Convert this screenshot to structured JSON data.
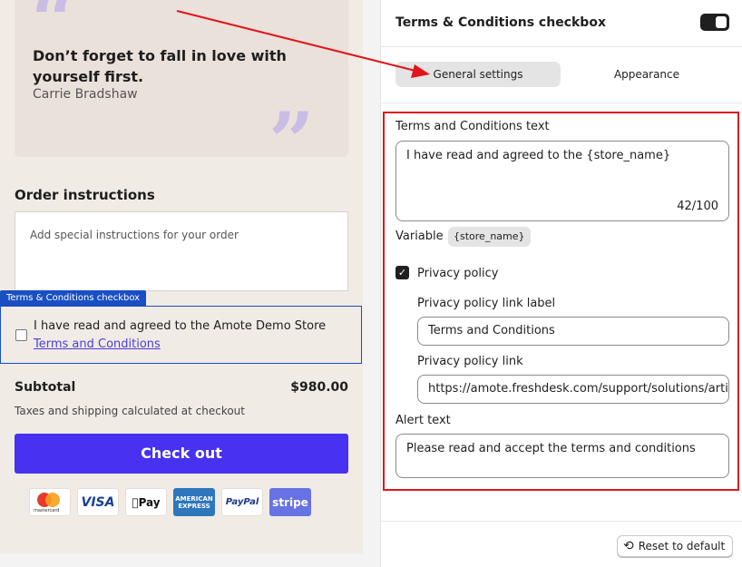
{
  "preview": {
    "quote": {
      "text": "Don’t forget to fall in love with yourself first.",
      "author": "Carrie Bradshaw"
    },
    "order_instructions": {
      "title": "Order instructions",
      "placeholder": "Add special instructions for your order"
    },
    "terms_block": {
      "tag": "Terms & Conditions checkbox",
      "text": "I have read and agreed to the Amote Demo Store",
      "link": "Terms and Conditions"
    },
    "subtotal": {
      "label": "Subtotal",
      "value": "$980.00",
      "note": "Taxes and shipping calculated at checkout"
    },
    "checkout_label": "Check out",
    "payments": [
      "mastercard",
      "VISA",
      "Pay",
      "AMERICAN EXPRESS",
      "PayPal",
      "stripe"
    ]
  },
  "panel": {
    "title": "Terms & Conditions checkbox",
    "toggle_on": true,
    "tabs": [
      {
        "label": "General settings",
        "active": true
      },
      {
        "label": "Appearance",
        "active": false
      }
    ],
    "terms_text": {
      "label": "Terms and Conditions text",
      "value": "I have read and agreed to the {store_name}",
      "counter": "42/100"
    },
    "variable": {
      "label": "Variable",
      "chip": "{store_name}"
    },
    "privacy_policy": {
      "label": "Privacy policy",
      "checked": true,
      "link_label_title": "Privacy policy link label",
      "link_label_value": "Terms and Conditions",
      "link_title": "Privacy policy link",
      "link_value": "https://amote.freshdesk.com/support/solutions/artic"
    },
    "alert": {
      "label": "Alert text",
      "value": "Please read and accept the terms and conditions"
    },
    "reset_label": "Reset to default"
  },
  "colors": {
    "accent": "#4632f0",
    "highlight": "#e1151d",
    "arrow": "#e1151d",
    "tag": "#1a4fc4"
  }
}
